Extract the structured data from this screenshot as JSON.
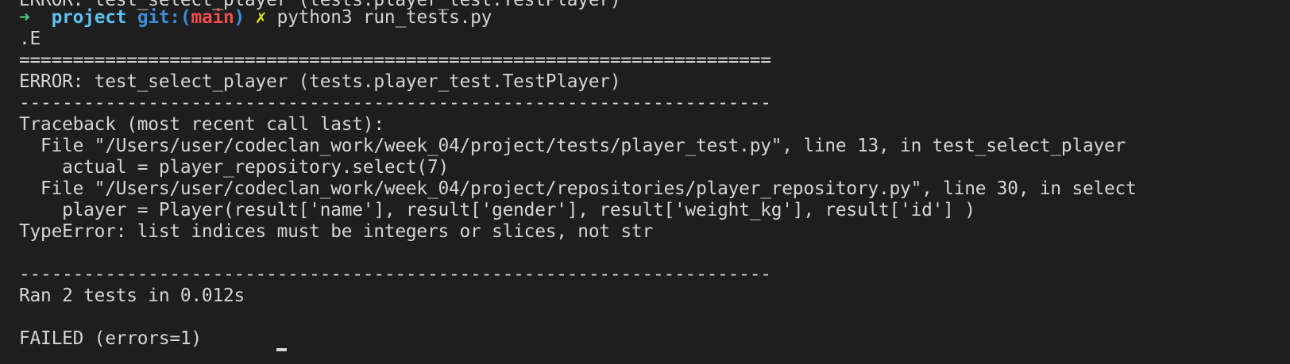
{
  "terminal": {
    "clipped_top_line": "ERROR: test_select_player (tests.player_test.TestPlayer)",
    "prompt": {
      "arrow": "➜",
      "directory": "project",
      "git_prefix": "git:(",
      "branch": "main",
      "git_suffix": ")",
      "dirty_mark": "✗",
      "command": "python3 run_tests.py"
    },
    "lines": {
      "dots": ".E",
      "separator_double": "======================================================================",
      "error_header": "ERROR: test_select_player (tests.player_test.TestPlayer)",
      "separator_single": "----------------------------------------------------------------------",
      "traceback_header": "Traceback (most recent call last):",
      "frame1_file": "  File \"/Users/user/codeclan_work/week_04/project/tests/player_test.py\", line 13, in test_select_player",
      "frame1_code": "    actual = player_repository.select(7)",
      "frame2_file": "  File \"/Users/user/codeclan_work/week_04/project/repositories/player_repository.py\", line 30, in select",
      "frame2_code": "    player = Player(result['name'], result['gender'], result['weight_kg'], result['id'] )",
      "type_error": "TypeError: list indices must be integers or slices, not str",
      "separator_bottom": "----------------------------------------------------------------------",
      "ran_summary": "Ran 2 tests in 0.012s",
      "failed_summary": "FAILED (errors=1)"
    }
  },
  "colors": {
    "background": "#1e1e1e",
    "foreground": "#d4d4d4",
    "arrow": "#4ec97a",
    "directory": "#5cc3f0",
    "git": "#3c8dd8",
    "branch": "#f14c4c",
    "dirty": "#e5e510"
  }
}
